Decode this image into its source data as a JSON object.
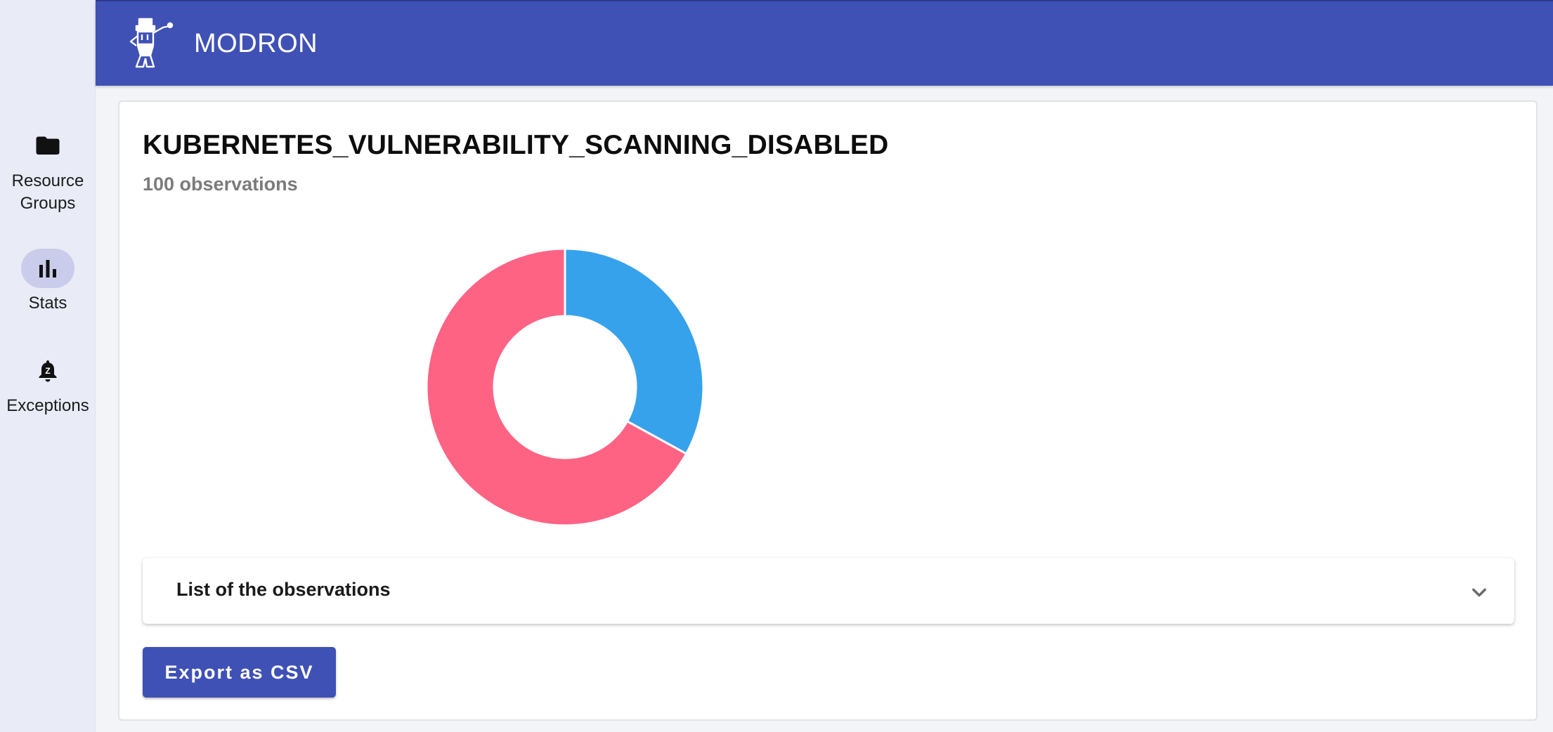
{
  "app": {
    "title": "MODRON",
    "brand_color": "#3f51b5"
  },
  "sidebar": {
    "items": [
      {
        "label": "Resource\nGroups",
        "icon": "folder-icon",
        "active": false
      },
      {
        "label": "Stats",
        "icon": "bar-chart-icon",
        "active": true
      },
      {
        "label": "Exceptions",
        "icon": "notification-bell-icon",
        "badge": "Z",
        "active": false
      }
    ]
  },
  "card": {
    "title": "KUBERNETES_VULNERABILITY_SCANNING_DISABLED",
    "subtitle": "100 observations"
  },
  "chart_data": {
    "type": "pie",
    "variant": "doughnut",
    "title": "",
    "slices": [
      {
        "label": "",
        "value": 33,
        "color": "#36a2eb"
      },
      {
        "label": "",
        "value": 67,
        "color": "#ff6384"
      }
    ],
    "legend": "none"
  },
  "accordion": {
    "label": "List of the observations",
    "expanded": false
  },
  "actions": {
    "export_label": "Export as CSV"
  }
}
